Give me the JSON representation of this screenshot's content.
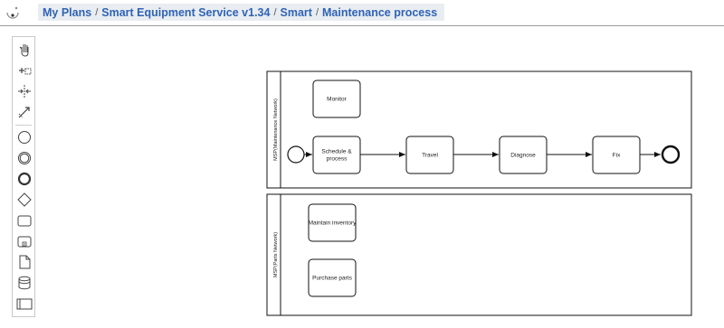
{
  "breadcrumb": {
    "items": [
      "My Plans",
      "Smart Equipment Service v1.34",
      "Smart",
      "Maintenance process"
    ],
    "separator": "/"
  },
  "palette": {
    "tools": [
      "hand-tool",
      "lasso-tool",
      "space-tool",
      "connect-tool",
      "start-event",
      "intermediate-event",
      "end-event",
      "gateway",
      "task",
      "subprocess",
      "data-object",
      "data-store",
      "pool"
    ]
  },
  "diagram": {
    "lanes": [
      {
        "label": "MSP(Maintenance Network)"
      },
      {
        "label": "MSP(Parts Network)"
      }
    ],
    "tasks": {
      "monitor": "Monitor",
      "schedule": [
        "Schedule &",
        "process"
      ],
      "travel": "Travel",
      "diagnose": "Diagnose",
      "fix": "Fix",
      "maintain_inventory": "Maintain inventory",
      "purchase_parts": "Purchase parts"
    }
  },
  "colors": {
    "link": "#2f63b6",
    "breadcrumb_bg": "#e9edf1",
    "stroke": "#111111"
  }
}
